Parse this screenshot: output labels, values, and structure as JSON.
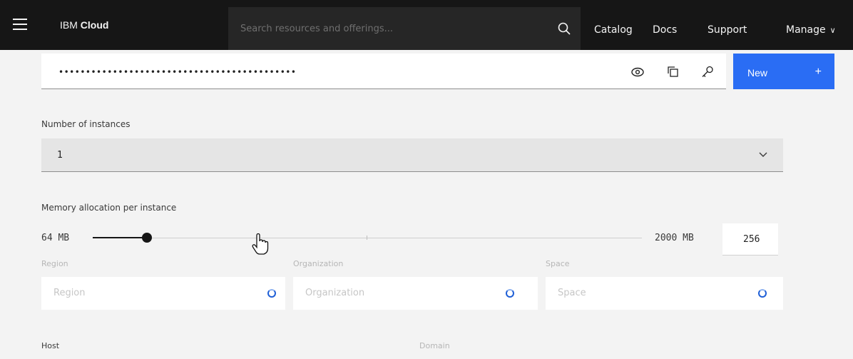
{
  "header": {
    "brand_prefix": "IBM",
    "brand_name": "Cloud",
    "search_placeholder": "Search resources and offerings...",
    "nav": {
      "catalog": "Catalog",
      "docs": "Docs",
      "support": "Support",
      "manage": "Manage"
    }
  },
  "password": {
    "masked_value": "••••••••••••••••••••••••••••••••••••••••••••",
    "new_button_label": "New",
    "new_button_plus": "+"
  },
  "instances": {
    "label": "Number of instances",
    "value": "1"
  },
  "memory": {
    "label": "Memory allocation per instance",
    "min_label": "64 MB",
    "max_label": "2000 MB",
    "value": "256",
    "slider": {
      "min": 64,
      "max": 2000,
      "value": 256
    }
  },
  "region": {
    "label": "Region",
    "placeholder": "Region"
  },
  "organization": {
    "label": "Organization",
    "placeholder": "Organization"
  },
  "space": {
    "label": "Space",
    "placeholder": "Space"
  },
  "host": {
    "label": "Host"
  },
  "domain": {
    "label": "Domain"
  },
  "colors": {
    "accent": "#2a6df4",
    "header_bg": "#161616",
    "spinner": "#1f5fd6"
  }
}
